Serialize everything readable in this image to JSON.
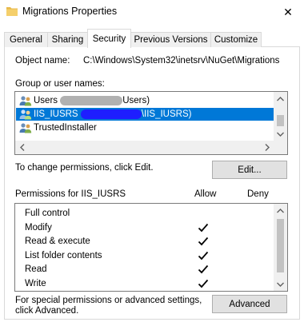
{
  "window": {
    "title": "Migrations Properties",
    "close_glyph": "✕"
  },
  "tabs": [
    {
      "label": "General"
    },
    {
      "label": "Sharing"
    },
    {
      "label": "Security"
    },
    {
      "label": "Previous Versions"
    },
    {
      "label": "Customize"
    }
  ],
  "object": {
    "label": "Object name:",
    "value": "C:\\Windows\\System32\\inetsrv\\NuGet\\Migrations"
  },
  "groups": {
    "label": "Group or user names:",
    "items": [
      {
        "prefix": "Users ",
        "suffix": "Users)"
      },
      {
        "prefix": "IIS_IUSRS ",
        "suffix": "\\IIS_IUSRS)"
      },
      {
        "prefix": "TrustedInstaller",
        "suffix": ""
      }
    ],
    "selected_index": 1
  },
  "edit_hint": "To change permissions, click Edit.",
  "edit_button": "Edit...",
  "permissions": {
    "header": "Permissions for IIS_IUSRS",
    "allow_label": "Allow",
    "deny_label": "Deny",
    "items": [
      {
        "name": "Full control",
        "allow": false,
        "deny": false
      },
      {
        "name": "Modify",
        "allow": true,
        "deny": false
      },
      {
        "name": "Read & execute",
        "allow": true,
        "deny": false
      },
      {
        "name": "List folder contents",
        "allow": true,
        "deny": false
      },
      {
        "name": "Read",
        "allow": true,
        "deny": false
      },
      {
        "name": "Write",
        "allow": true,
        "deny": false
      }
    ]
  },
  "advanced": {
    "hint_line1": "For special permissions or advanced settings,",
    "hint_line2": "click Advanced.",
    "button": "Advanced"
  },
  "icons": {
    "folder": "folder-icon",
    "user_group": "user-group-icon",
    "check": "checkmark-icon",
    "close": "close-icon"
  },
  "colors": {
    "selection": "#0078d7",
    "redaction_gray": "#9e9e9e",
    "redaction_blue": "#1e1eff",
    "folder": "#e8b94a"
  }
}
